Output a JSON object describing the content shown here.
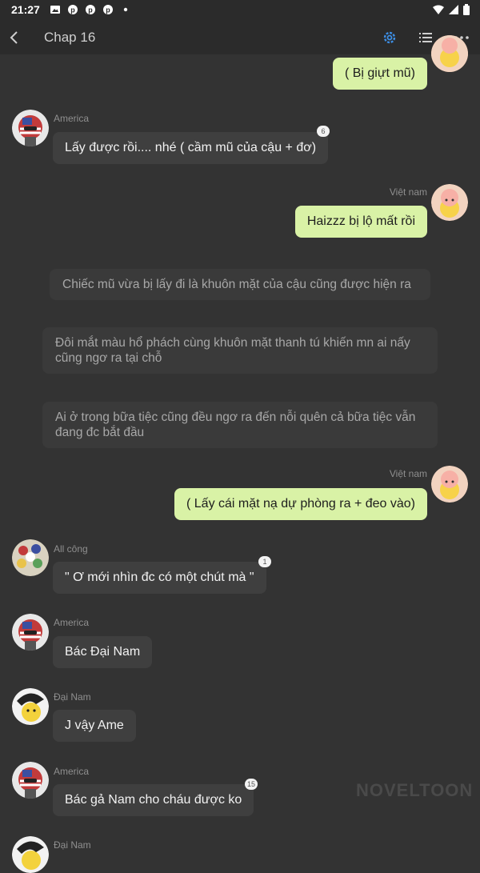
{
  "status_bar": {
    "time": "21:27"
  },
  "header": {
    "title": "Chap 16",
    "icons": [
      "back-icon",
      "settings-icon",
      "list-icon",
      "more-icon"
    ]
  },
  "messages": [
    {
      "type": "right",
      "speaker": "",
      "text": "( Bị giựt mũ)"
    },
    {
      "type": "left",
      "speaker": "America",
      "text": "Lấy được rồi.... nhé ( cầm mũ của cậu + đơ)",
      "badge": "6"
    },
    {
      "type": "right",
      "speaker": "Việt nam",
      "text": "Haizzz bị lộ mất rồi"
    },
    {
      "type": "narration",
      "text": "Chiếc mũ vừa bị lấy đi là khuôn mặt của cậu cũng được hiện ra"
    },
    {
      "type": "narration",
      "text": "Đôi mắt màu hổ phách cùng khuôn mặt thanh tú khiến mn ai nấy cũng ngơ ra tại chỗ"
    },
    {
      "type": "narration",
      "text": "Ai ở trong bữa tiệc cũng đều ngơ ra đến nỗi quên cả bữa tiệc vẫn đang đc bắt đầu"
    },
    {
      "type": "right",
      "speaker": "Việt nam",
      "text": "( Lấy cái mặt nạ dự phòng ra + đeo vào)"
    },
    {
      "type": "left",
      "speaker": "All công",
      "text": "\" Ơ mới nhìn đc có một chút mà \"",
      "badge": "1"
    },
    {
      "type": "left",
      "speaker": "America",
      "text": "Bác Đại Nam"
    },
    {
      "type": "left",
      "speaker": "Đại Nam",
      "text": "J vậy Ame"
    },
    {
      "type": "left",
      "speaker": "America",
      "text": "Bác gả Nam cho cháu được ko",
      "badge": "15"
    },
    {
      "type": "left",
      "speaker": "Đại Nam",
      "text": ""
    }
  ],
  "watermark": "NOVELTOON",
  "colors": {
    "background": "#333333",
    "bar": "#2b2b2b",
    "right_bubble": "#d9f2a6",
    "left_bubble": "#3f3f3f",
    "accent": "#3d8fe6"
  }
}
